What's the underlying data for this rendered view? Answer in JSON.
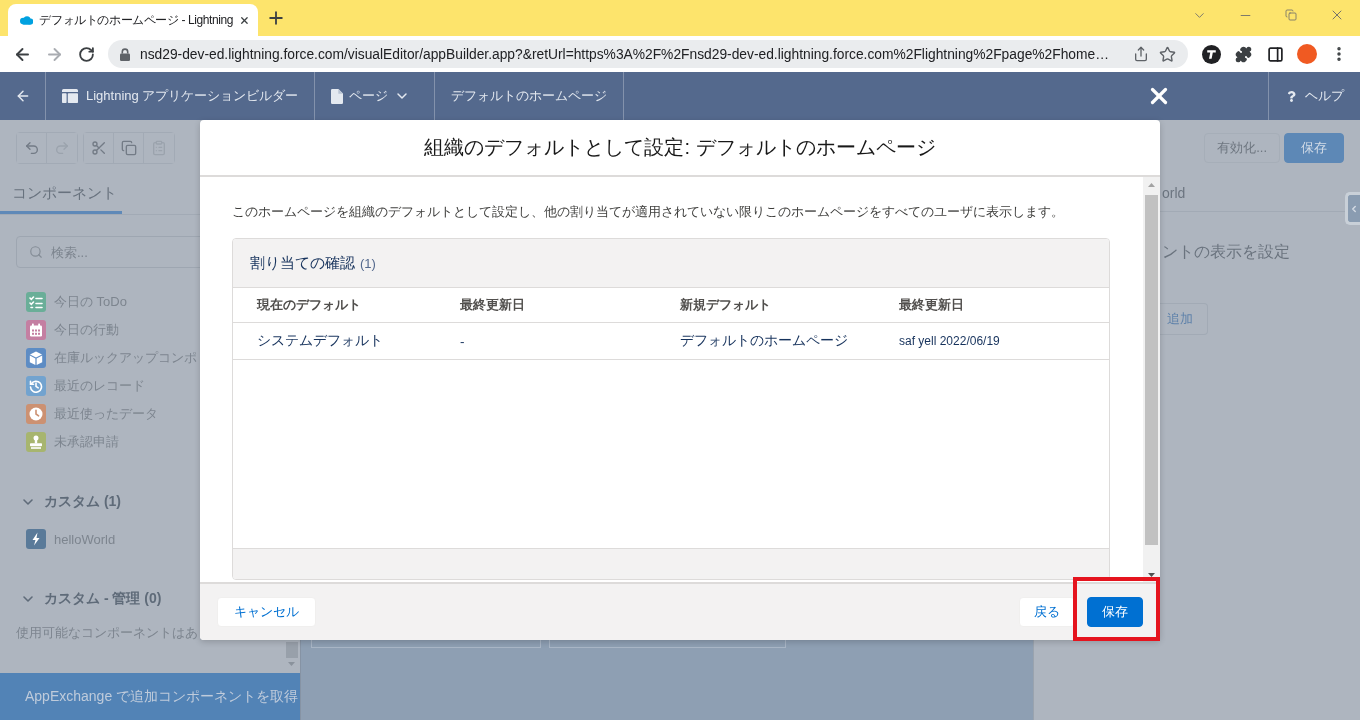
{
  "browser": {
    "tab_title": "デフォルトのホームページ - Lightning",
    "url": "nsd29-dev-ed.lightning.force.com/visualEditor/appBuilder.app?&retUrl=https%3A%2F%2Fnsd29-dev-ed.lightning.force.com%2Flightning%2Fpage%2Fhome…"
  },
  "app_header": {
    "app_title": "Lightning アプリケーションビルダー",
    "page_menu": "ページ",
    "page_title": "デフォルトのホームページ",
    "help": "ヘルプ"
  },
  "toolbar_groups": [
    {
      "buttons": [
        {
          "disabled": false
        },
        {
          "disabled": true
        }
      ]
    },
    {
      "buttons": [
        {
          "disabled": false
        },
        {
          "disabled": false
        },
        {
          "disabled": true
        }
      ]
    }
  ],
  "left_panel": {
    "tabs": [
      {
        "label": "コンポーネント",
        "selected": true
      }
    ],
    "search": {
      "placeholder": "検索..."
    },
    "standard_components": [
      {
        "label": "今日の ToDo",
        "color": "#6aae98"
      },
      {
        "label": "今日の行動",
        "color": "#c47fa2"
      },
      {
        "label": "在庫ルックアップコンポ",
        "color": "#5d8cc4"
      },
      {
        "label": "最近のレコード",
        "color": "#72a3cf"
      },
      {
        "label": "最近使ったデータ",
        "color": "#cc9172"
      },
      {
        "label": "未承認申請",
        "color": "#a7b56f"
      }
    ],
    "sections": [
      {
        "title": "カスタム (1)",
        "expanded": true,
        "components": [
          {
            "label": "helloWorld",
            "color": "#5a7a99"
          }
        ]
      },
      {
        "title": "カスタム - 管理 (0)",
        "expanded": true,
        "empty_message": "使用可能なコンポーネントはあ"
      }
    ],
    "appexchange_link": "AppExchange で追加コンポーネントを取得"
  },
  "right_panel": {
    "buttons": [
      {
        "label": "有効化...",
        "kind": "activate",
        "disabled": true
      },
      {
        "label": "保存",
        "kind": "save",
        "disabled": false
      }
    ],
    "tab_label": "orld",
    "heading": "ントの表示を設定",
    "add_button": "追加"
  },
  "modal": {
    "title": "組織のデフォルトとして設定: デフォルトのホームページ",
    "description": "このホームページを組織のデフォルトとして設定し、他の割り当てが適用されていない限りこのホームページをすべてのユーザに表示します。",
    "card": {
      "title": "割り当ての確認",
      "count": "(1)",
      "columns": [
        "現在のデフォルト",
        "最終更新日",
        "新規デフォルト",
        "最終更新日"
      ],
      "rows": [
        [
          "システムデフォルト",
          "-",
          "デフォルトのホームページ",
          "saf yell 2022/06/19"
        ]
      ]
    },
    "footer": {
      "left_buttons": [
        {
          "label": "キャンセル",
          "kind": "cancel",
          "highlighted": false
        }
      ],
      "right_buttons": [
        {
          "label": "戻る",
          "kind": "back",
          "highlighted": false
        },
        {
          "label": "保存",
          "kind": "save",
          "highlighted": true
        }
      ]
    }
  }
}
